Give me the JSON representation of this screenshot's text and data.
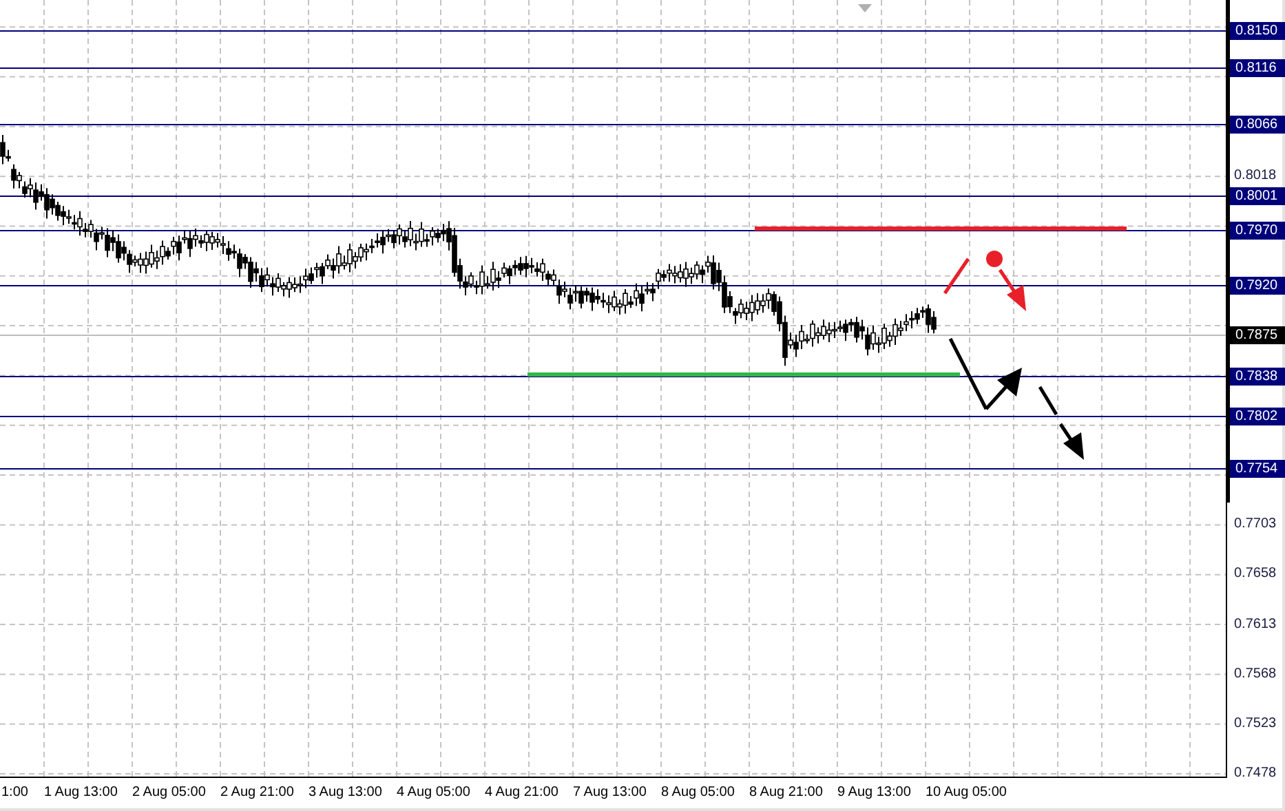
{
  "price_axis": {
    "levels": [
      {
        "label": "0.8150"
      },
      {
        "label": "0.8116"
      },
      {
        "label": "0.8066"
      },
      {
        "label": "0.8001"
      },
      {
        "label": "0.7970"
      },
      {
        "label": "0.7920"
      },
      {
        "label": "0.7838"
      },
      {
        "label": "0.7802"
      },
      {
        "label": "0.7754"
      }
    ],
    "current_price": "0.7875",
    "ticks": [
      "0.8018",
      "0.7703",
      "0.7658",
      "0.7613",
      "0.7568",
      "0.7523",
      "0.7478"
    ]
  },
  "time_axis": {
    "labels": [
      "1:00",
      "1 Aug 13:00",
      "2 Aug 05:00",
      "2 Aug 21:00",
      "3 Aug 13:00",
      "4 Aug 05:00",
      "4 Aug 21:00",
      "7 Aug 13:00",
      "8 Aug 05:00",
      "8 Aug 21:00",
      "9 Aug 13:00",
      "10 Aug 05:00"
    ]
  }
}
